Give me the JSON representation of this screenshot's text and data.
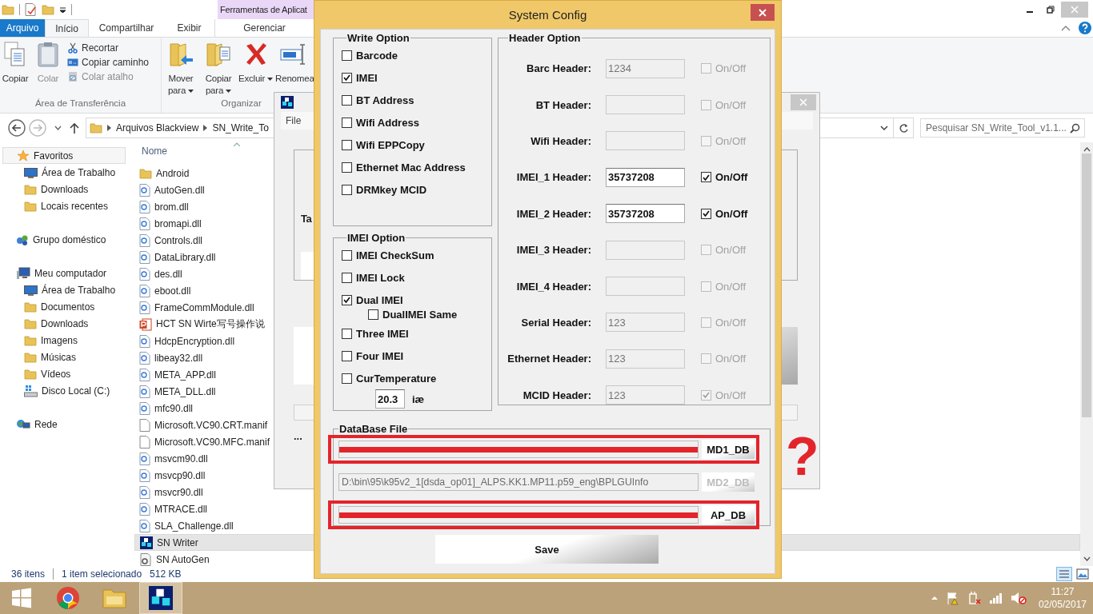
{
  "explorer": {
    "context_tab": "Ferramentas de Aplicat",
    "tabs": [
      {
        "label": "Arquivo",
        "kind": "file",
        "selected": false
      },
      {
        "label": "Início",
        "kind": "tab",
        "selected": true
      },
      {
        "label": "Compartilhar",
        "kind": "tab",
        "selected": false
      },
      {
        "label": "Exibir",
        "kind": "tab",
        "selected": false
      },
      {
        "label": "Gerenciar",
        "kind": "context",
        "selected": false
      }
    ],
    "ribbon_groups": [
      {
        "label": "Área de Transferência",
        "buttons": [
          {
            "label": "Copiar",
            "kind": "large",
            "disabled": false,
            "dropdown": false
          },
          {
            "label": "Colar",
            "kind": "large",
            "disabled": true,
            "dropdown": false
          },
          {
            "label": "Recortar",
            "kind": "small",
            "disabled": false
          },
          {
            "label": "Copiar caminho",
            "kind": "small",
            "disabled": false
          },
          {
            "label": "Colar atalho",
            "kind": "small",
            "disabled": true
          }
        ]
      },
      {
        "label": "Organizar",
        "buttons": [
          {
            "label": "Mover para",
            "kind": "large",
            "disabled": false,
            "dropdown": true
          },
          {
            "label": "Copiar para",
            "kind": "large",
            "disabled": false,
            "dropdown": true
          },
          {
            "label": "Excluir",
            "kind": "large",
            "disabled": false,
            "dropdown": true
          },
          {
            "label": "Renomea",
            "kind": "large",
            "disabled": false,
            "dropdown": false
          }
        ]
      }
    ],
    "address": {
      "crumbs": [
        "Arquivos Blackview",
        "SN_Write_To"
      ]
    },
    "search": {
      "placeholder": "Pesquisar SN_Write_Tool_v1.1..."
    },
    "nav": [
      {
        "label": "Favoritos",
        "selected": true,
        "children": [
          {
            "label": "Área de Trabalho",
            "selected": false
          },
          {
            "label": "Downloads",
            "selected": false
          },
          {
            "label": "Locais recentes",
            "selected": false
          }
        ]
      },
      {
        "label": "Grupo doméstico",
        "selected": false
      },
      {
        "label": "Meu computador",
        "selected": false,
        "children": [
          {
            "label": "Área de Trabalho",
            "selected": false
          },
          {
            "label": "Documentos",
            "selected": false
          },
          {
            "label": "Downloads",
            "selected": false
          },
          {
            "label": "Imagens",
            "selected": false
          },
          {
            "label": "Músicas",
            "selected": false
          },
          {
            "label": "Vídeos",
            "selected": false
          },
          {
            "label": "Disco Local (C:)",
            "selected": false
          }
        ]
      },
      {
        "label": "Rede",
        "selected": false
      }
    ],
    "files": {
      "column": "Nome",
      "rows": [
        {
          "name": "Android",
          "kind": "folder",
          "selected": false
        },
        {
          "name": "AutoGen.dll",
          "kind": "dll",
          "selected": false
        },
        {
          "name": "brom.dll",
          "kind": "dll",
          "selected": false
        },
        {
          "name": "bromapi.dll",
          "kind": "dll",
          "selected": false
        },
        {
          "name": "Controls.dll",
          "kind": "dll",
          "selected": false
        },
        {
          "name": "DataLibrary.dll",
          "kind": "dll",
          "selected": false
        },
        {
          "name": "des.dll",
          "kind": "dll",
          "selected": false
        },
        {
          "name": "eboot.dll",
          "kind": "dll",
          "selected": false
        },
        {
          "name": "FrameCommModule.dll",
          "kind": "dll",
          "selected": false
        },
        {
          "name": "HCT SN Wirte写号操作说",
          "kind": "slides",
          "selected": false
        },
        {
          "name": "HdcpEncryption.dll",
          "kind": "dll",
          "selected": false
        },
        {
          "name": "libeay32.dll",
          "kind": "dll",
          "selected": false
        },
        {
          "name": "META_APP.dll",
          "kind": "dll",
          "selected": false
        },
        {
          "name": "META_DLL.dll",
          "kind": "dll",
          "selected": false
        },
        {
          "name": "mfc90.dll",
          "kind": "dll",
          "selected": false
        },
        {
          "name": "Microsoft.VC90.CRT.manif",
          "kind": "file",
          "selected": false
        },
        {
          "name": "Microsoft.VC90.MFC.manif",
          "kind": "file",
          "selected": false
        },
        {
          "name": "msvcm90.dll",
          "kind": "dll",
          "selected": false
        },
        {
          "name": "msvcp90.dll",
          "kind": "dll",
          "selected": false
        },
        {
          "name": "msvcr90.dll",
          "kind": "dll",
          "selected": false
        },
        {
          "name": "MTRACE.dll",
          "kind": "dll",
          "selected": false
        },
        {
          "name": "SLA_Challenge.dll",
          "kind": "dll",
          "selected": false
        },
        {
          "name": "SN Writer",
          "kind": "app",
          "selected": true
        },
        {
          "name": "SN AutoGen",
          "kind": "tool",
          "selected": false
        }
      ]
    },
    "status": {
      "count": "36 itens",
      "selection": "1 item selecionado",
      "size": "512 KB"
    }
  },
  "sn_writer": {
    "menu": [
      "File"
    ],
    "label": "Ta",
    "ellipsis": "..."
  },
  "dialog": {
    "title": "System Config",
    "write_option": {
      "title": "Write Option",
      "items": [
        {
          "label": "Barcode",
          "checked": false
        },
        {
          "label": "IMEI",
          "checked": true
        },
        {
          "label": "BT Address",
          "checked": false
        },
        {
          "label": "Wifi Address",
          "checked": false
        },
        {
          "label": "Wifi EPPCopy",
          "checked": false
        },
        {
          "label": "Ethernet Mac Address",
          "checked": false
        },
        {
          "label": "DRMkey MCID",
          "checked": false
        }
      ]
    },
    "imei_option": {
      "title": "IMEI Option",
      "items": [
        {
          "label": "IMEI CheckSum",
          "checked": false
        },
        {
          "label": "IMEI Lock",
          "checked": false
        },
        {
          "label": "Dual IMEI",
          "checked": true,
          "children": [
            {
              "label": "DualIMEI Same",
              "checked": false
            }
          ]
        },
        {
          "label": "Three IMEI",
          "checked": false
        },
        {
          "label": "Four IMEI",
          "checked": false
        },
        {
          "label": "CurTemperature",
          "checked": false
        }
      ],
      "temperature": {
        "value": "20.3",
        "unit": "iæ"
      }
    },
    "header_option": {
      "title": "Header Option",
      "rows": [
        {
          "label": "Barc Header:",
          "value": "1234",
          "disabled": true,
          "checked": false,
          "toggle": "On/Off"
        },
        {
          "label": "BT Header:",
          "disabled": true,
          "checked": false,
          "toggle": "On/Off"
        },
        {
          "label": "Wifi Header:",
          "disabled": true,
          "checked": false,
          "toggle": "On/Off"
        },
        {
          "label": "IMEI_1 Header:",
          "value": "35737208",
          "disabled": false,
          "checked": true,
          "toggle": "On/Off"
        },
        {
          "label": "IMEI_2 Header:",
          "value": "35737208",
          "disabled": false,
          "checked": true,
          "toggle": "On/Off"
        },
        {
          "label": "IMEI_3 Header:",
          "disabled": true,
          "checked": false,
          "toggle": "On/Off"
        },
        {
          "label": "IMEI_4 Header:",
          "disabled": true,
          "checked": false,
          "toggle": "On/Off"
        },
        {
          "label": "Serial Header:",
          "value": "123",
          "disabled": true,
          "checked": false,
          "toggle": "On/Off"
        },
        {
          "label": "Ethernet Header:",
          "value": "123",
          "disabled": true,
          "checked": false,
          "toggle": "On/Off"
        },
        {
          "label": "MCID Header:",
          "value": "123",
          "disabled": true,
          "checked": true,
          "toggle": "On/Off"
        }
      ]
    },
    "database": {
      "title": "DataBase File",
      "rows": [
        {
          "button": "MD1_DB",
          "redacted": true,
          "highlighted": true,
          "disabled": false
        },
        {
          "value": "D:\\bin\\95\\k95v2_1[dsda_op01]_ALPS.KK1.MP11.p59_eng\\BPLGUInfo",
          "button": "MD2_DB",
          "redacted": false,
          "highlighted": false,
          "disabled": true
        },
        {
          "button": "AP_DB",
          "redacted": true,
          "highlighted": true,
          "disabled": false
        }
      ]
    },
    "save": "Save"
  },
  "annotation": {
    "mark": "?"
  },
  "taskbar": {
    "apps": [
      {
        "selected": false
      },
      {
        "selected": false
      },
      {
        "selected": true
      }
    ],
    "clock": {
      "time": "11:27",
      "date": "02/05/2017"
    }
  }
}
